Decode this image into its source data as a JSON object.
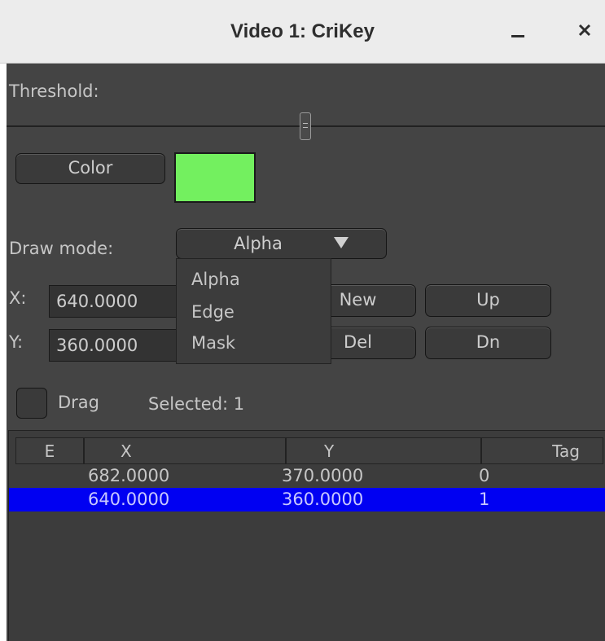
{
  "window": {
    "title": "Video 1: CriKey",
    "minimize_label": "–",
    "close_label": "×"
  },
  "threshold": {
    "label": "Threshold:"
  },
  "color": {
    "button_label": "Color",
    "swatch_color": "#73f05f"
  },
  "draw_mode": {
    "label": "Draw mode:",
    "selected": "Alpha",
    "options": [
      "Alpha",
      "Edge",
      "Mask"
    ]
  },
  "point": {
    "x_label": "X:",
    "x_value": "640.0000",
    "y_label": "Y:",
    "y_value": "360.0000"
  },
  "buttons": {
    "new_label": "New",
    "del_label": "Del",
    "up_label": "Up",
    "dn_label": "Dn"
  },
  "drag": {
    "label": "Drag",
    "selected_text": "Selected: 1"
  },
  "table": {
    "columns": [
      "E",
      "X",
      "Y",
      "Tag"
    ],
    "rows": [
      {
        "e": "",
        "x": "682.0000",
        "y": "370.0000",
        "tag": "0",
        "selected": false
      },
      {
        "e": "",
        "x": "640.0000",
        "y": "360.0000",
        "tag": "1",
        "selected": true
      }
    ]
  },
  "colors": {
    "panel_bg": "#444444",
    "selection": "#0000f2",
    "swatch": "#73f05f"
  },
  "icons": {
    "dropdown": "triangle-down-icon",
    "close": "close-icon",
    "minimize": "minimize-icon"
  }
}
